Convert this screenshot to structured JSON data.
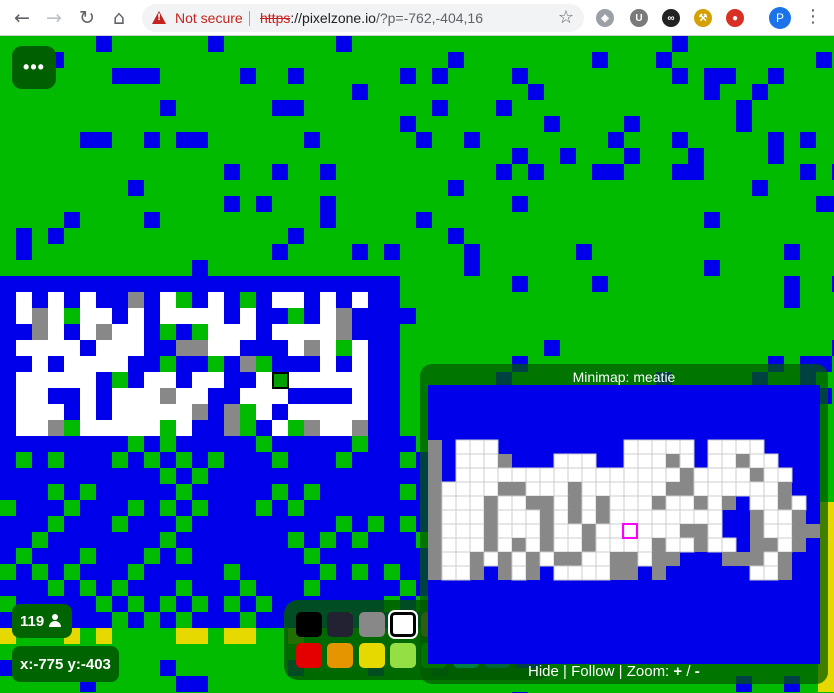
{
  "browser": {
    "back_icon": "←",
    "forward_icon": "→",
    "reload_icon": "↻",
    "home_icon": "⌂",
    "not_secure_label": "Not secure",
    "url_scheme": "https",
    "url_host": "://pixelzone.io",
    "url_rest": "/?p=-762,-404,16",
    "star_icon": "☆",
    "extensions": [
      {
        "name": "shield",
        "glyph": "◈",
        "color": "#9aa0a6"
      },
      {
        "name": "u",
        "glyph": "U",
        "color": "#7a7a7a"
      },
      {
        "name": "loop",
        "glyph": "∞",
        "color": "#222222"
      },
      {
        "name": "broom",
        "glyph": "⚒",
        "color": "#d4a000"
      },
      {
        "name": "record",
        "glyph": "●",
        "color": "#d93025"
      }
    ],
    "profile_initial": "P",
    "menu_icon": "⋮"
  },
  "game": {
    "menu_button_label": "•••",
    "online_count": "119",
    "coords": "x:-775 y:-403",
    "palette": [
      "#000000",
      "#222233",
      "#888888",
      "#ffffff",
      "#a06a42",
      "#ffa7d1",
      "#cf6ee4",
      "#820080",
      "#e50000",
      "#e59500",
      "#e5d900",
      "#94e044",
      "#02be01",
      "#00e5f0",
      "#0083c7",
      "#0000ea"
    ],
    "selected_color_index": 3,
    "minimap": {
      "title": "Minimap: meatie",
      "hide_label": "Hide",
      "sep1": "|",
      "follow_label": "Follow",
      "sep2": "|",
      "zoom_label": "Zoom:",
      "zoom_in": "+",
      "slash": "/",
      "zoom_out": "-"
    },
    "colors": {
      "green": "#00bb00",
      "blue": "#0000ea",
      "white": "#ffffff",
      "gray": "#888888",
      "yellow": "#e5d900",
      "dark_green": "#006400",
      "magenta": "#ff00ff"
    }
  }
}
